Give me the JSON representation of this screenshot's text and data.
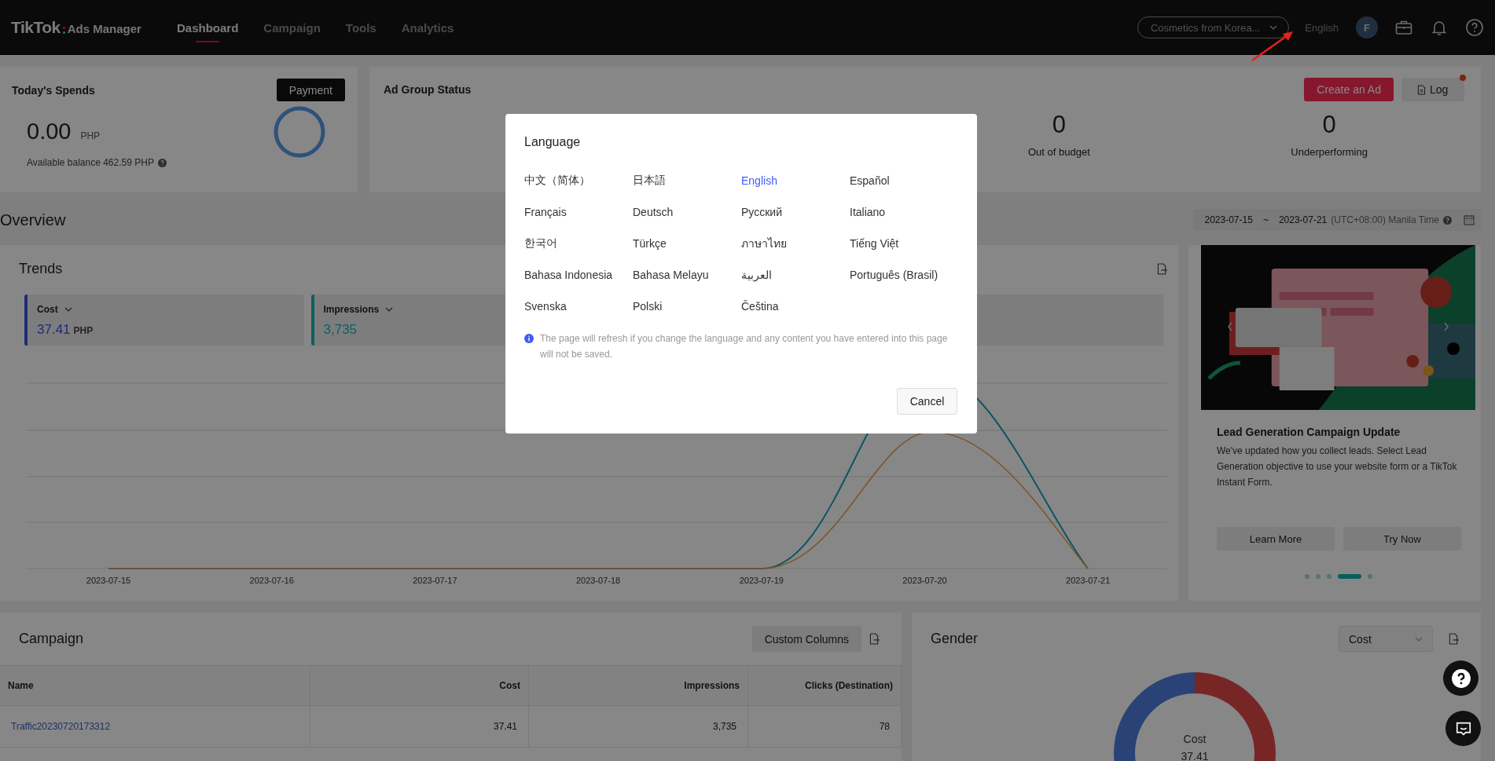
{
  "nav": {
    "logo": "TikTok",
    "logo_suffix": "Ads Manager",
    "tabs": [
      {
        "label": "Dashboard",
        "selected": true
      },
      {
        "label": "Campaign",
        "selected": false
      },
      {
        "label": "Tools",
        "selected": false
      },
      {
        "label": "Analytics",
        "selected": false
      }
    ],
    "account": "Cosmetics from Korea...",
    "language": "English",
    "avatar_initial": "F"
  },
  "spends": {
    "title": "Today's Spends",
    "button": "Payment",
    "amount": "0.00",
    "currency": "PHP",
    "balance": "Available balance 462.59 PHP"
  },
  "ad_group_status": {
    "title": "Ad Group Status",
    "create_button": "Create an Ad",
    "log_button": "Log",
    "log_notification": true,
    "metrics": [
      {
        "value": "0",
        "label": "Out of budget"
      },
      {
        "value": "0",
        "label": "Underperforming"
      }
    ]
  },
  "overview": {
    "title": "Overview",
    "date_start": "2023-07-15",
    "separator": "~",
    "date_end": "2023-07-21",
    "timezone": "(UTC+08:00) Manila Time"
  },
  "trends": {
    "title": "Trends",
    "metrics": [
      {
        "label": "Cost",
        "value": "37.41",
        "unit": "PHP",
        "color": "#202b77"
      },
      {
        "label": "Impressions",
        "value": "3,735",
        "color": "#0d5f5f"
      }
    ],
    "x_labels": [
      "2023-07-15",
      "2023-07-16",
      "2023-07-17",
      "2023-07-18",
      "2023-07-19",
      "2023-07-20",
      "2023-07-21"
    ]
  },
  "banner": {
    "title": "Lead Generation Campaign Update",
    "text": "We've updated how you collect leads. Select Lead Generation objective to use your website form or a TikTok Instant Form.",
    "buttons": [
      "Learn More",
      "Try Now"
    ],
    "dots": [
      {
        "selected": false
      },
      {
        "selected": false
      },
      {
        "selected": false
      },
      {
        "selected": true
      },
      {
        "selected": false
      }
    ]
  },
  "campaign": {
    "title": "Campaign",
    "button": "Custom Columns",
    "columns": [
      "Name",
      "Cost",
      "Impressions",
      "Clicks (Destination)"
    ],
    "rows": [
      [
        "Traffic20230720173312",
        "37.41",
        "3,735",
        "78"
      ]
    ]
  },
  "gender": {
    "title": "Gender",
    "metric_select": "Cost",
    "donut_label": "Cost",
    "donut_value": "37.41"
  },
  "dialog": {
    "title": "Language",
    "languages": [
      {
        "label": "中文（简体）",
        "selected": false
      },
      {
        "label": "日本語",
        "selected": false
      },
      {
        "label": "English",
        "selected": true
      },
      {
        "label": "Español",
        "selected": false
      },
      {
        "label": "Français",
        "selected": false
      },
      {
        "label": "Deutsch",
        "selected": false
      },
      {
        "label": "Русский",
        "selected": false
      },
      {
        "label": "Italiano",
        "selected": false
      },
      {
        "label": "한국어",
        "selected": false
      },
      {
        "label": "Türkçe",
        "selected": false
      },
      {
        "label": "ภาษาไทย",
        "selected": false
      },
      {
        "label": "Tiếng Việt",
        "selected": false
      },
      {
        "label": "Bahasa Indonesia",
        "selected": false
      },
      {
        "label": "Bahasa Melayu",
        "selected": false
      },
      {
        "label": "العربية",
        "selected": false
      },
      {
        "label": "Português (Brasil)",
        "selected": false
      },
      {
        "label": "Svenska",
        "selected": false
      },
      {
        "label": "Polski",
        "selected": false
      },
      {
        "label": "Čeština",
        "selected": false
      }
    ],
    "note": "The page will refresh if you change the language and any content you have entered into this page will not be saved.",
    "cancel": "Cancel"
  }
}
